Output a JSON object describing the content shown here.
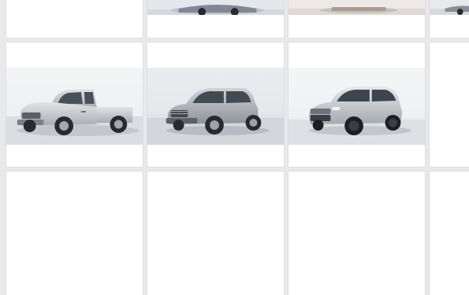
{
  "listing_grid": {
    "columns": 4,
    "rows": [
      {
        "cards": [
          {
            "image": "none"
          },
          {
            "image": "car-photo-partial"
          },
          {
            "image": "car-photo-partial"
          },
          {
            "image": "car-photo-partial"
          }
        ]
      },
      {
        "cards": [
          {
            "image": "silver-pickup-truck-photo"
          },
          {
            "image": "silver-compact-suv-photo"
          },
          {
            "image": "silver-crossover-suv-photo"
          },
          {
            "image": "none"
          }
        ]
      },
      {
        "cards": [
          {
            "image": "none"
          },
          {
            "image": "none"
          },
          {
            "image": "none"
          },
          {
            "image": "none"
          }
        ]
      }
    ]
  },
  "colors": {
    "page_background": "#e9e9ec",
    "card_background": "#ffffff",
    "card_border": "#dedee2",
    "vehicle_silver": "#c3c6ca",
    "tire": "#2a2a2c"
  }
}
